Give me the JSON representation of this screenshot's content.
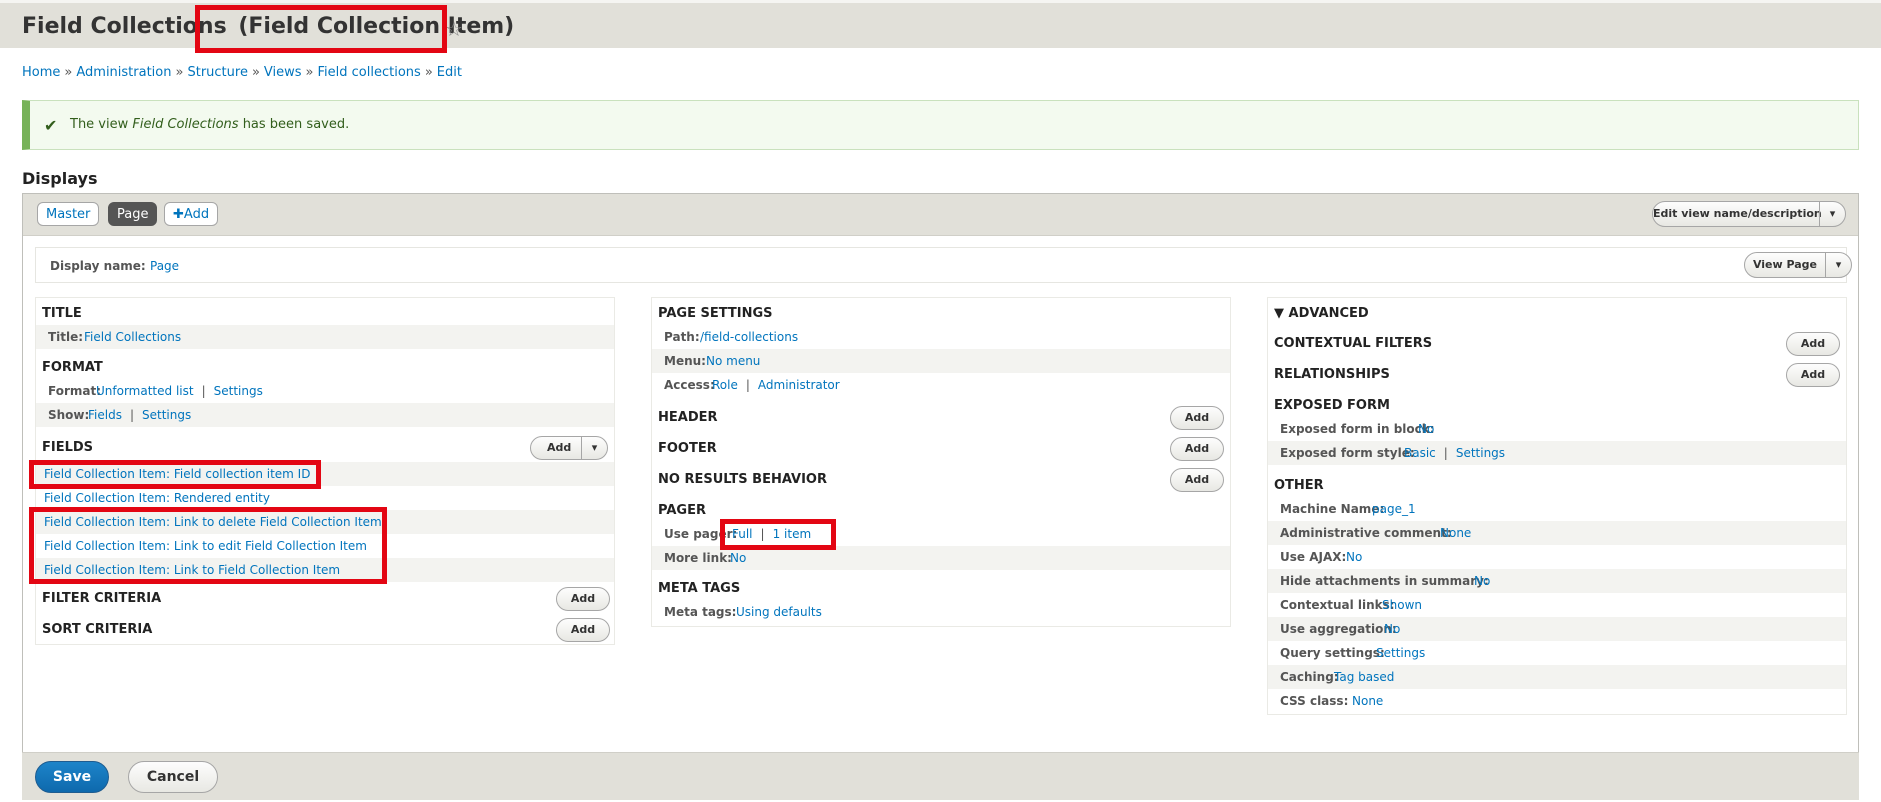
{
  "page": {
    "title": "Field Collections",
    "title_suffix": "(Field Collection Item)"
  },
  "breadcrumb": [
    "Home",
    "Administration",
    "Structure",
    "Views",
    "Field collections",
    "Edit"
  ],
  "breadcrumb_separator": "»",
  "message": {
    "prefix": "The view ",
    "view_name": "Field Collections",
    "suffix": " has been saved."
  },
  "displays": {
    "label": "Displays",
    "tabs": [
      "Master",
      "Page",
      "Add"
    ],
    "active_tab": "Page",
    "add_icon": "plus-icon",
    "edit_view_button": "Edit view name/description"
  },
  "display_name": {
    "label": "Display name:",
    "value": "Page",
    "view_page_button": "View Page"
  },
  "left": {
    "title_section": "TITLE",
    "title_label": "Title:",
    "title_value": "Field Collections",
    "format_section": "FORMAT",
    "format_label": "Format:",
    "format_value": "Unformatted list",
    "format_settings": "Settings",
    "show_label": "Show:",
    "show_value": "Fields",
    "show_settings": "Settings",
    "fields_section": "FIELDS",
    "fields_add": "Add",
    "fields": [
      "Field Collection Item: Field collection item ID",
      "Field Collection Item: Rendered entity",
      "Field Collection Item: Link to delete Field Collection Item",
      "Field Collection Item: Link to edit Field Collection Item",
      "Field Collection Item: Link to Field Collection Item"
    ],
    "filter_section": "FILTER CRITERIA",
    "filter_add": "Add",
    "sort_section": "SORT CRITERIA",
    "sort_add": "Add"
  },
  "middle": {
    "page_settings_section": "PAGE SETTINGS",
    "path_label": "Path:",
    "path_value": "/field-collections",
    "menu_label": "Menu:",
    "menu_value": "No menu",
    "access_label": "Access:",
    "access_value": "Role",
    "access_value2": "Administrator",
    "header_section": "HEADER",
    "header_add": "Add",
    "footer_section": "FOOTER",
    "footer_add": "Add",
    "no_results_section": "NO RESULTS BEHAVIOR",
    "no_results_add": "Add",
    "pager_section": "PAGER",
    "use_pager_label": "Use pager:",
    "use_pager_value": "Full",
    "use_pager_value2": "1 item",
    "more_link_label": "More link:",
    "more_link_value": "No",
    "meta_tags_section": "META TAGS",
    "meta_tags_label": "Meta tags:",
    "meta_tags_value": "Using defaults"
  },
  "right": {
    "advanced_toggle": "ADVANCED",
    "advanced_icon": "triangle-down-icon",
    "contextual_filters_section": "CONTEXTUAL FILTERS",
    "contextual_filters_add": "Add",
    "relationships_section": "RELATIONSHIPS",
    "relationships_add": "Add",
    "exposed_form_section": "EXPOSED FORM",
    "exposed_in_block_label": "Exposed form in block:",
    "exposed_in_block_value": "No",
    "exposed_style_label": "Exposed form style:",
    "exposed_style_value": "Basic",
    "exposed_style_settings": "Settings",
    "other_section": "OTHER",
    "other_rows": [
      {
        "label": "Machine Name:",
        "value": "page_1"
      },
      {
        "label": "Administrative comment:",
        "value": "None"
      },
      {
        "label": "Use AJAX:",
        "value": "No"
      },
      {
        "label": "Hide attachments in summary:",
        "value": "No"
      },
      {
        "label": "Contextual links:",
        "value": "Shown"
      },
      {
        "label": "Use aggregation:",
        "value": "No"
      },
      {
        "label": "Query settings:",
        "value": "Settings"
      },
      {
        "label": "Caching:",
        "value": "Tag based"
      },
      {
        "label": "CSS class:",
        "value": "None"
      }
    ]
  },
  "actions": {
    "save": "Save",
    "cancel": "Cancel"
  },
  "colors": {
    "link": "#0074bd",
    "highlight": "#e30613",
    "status_green": "#77b259",
    "primary_button": "#0e69ad"
  }
}
